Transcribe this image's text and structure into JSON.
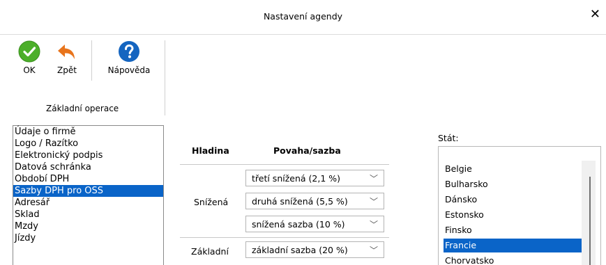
{
  "window": {
    "title": "Nastavení agendy",
    "close_glyph": "✕"
  },
  "toolbar": {
    "ok_label": "OK",
    "back_label": "Zpět",
    "help_label": "Nápověda",
    "group_label": "Základní operace",
    "icons": {
      "ok": "check-circle-icon",
      "back": "undo-arrow-icon",
      "help": "question-circle-icon"
    },
    "colors": {
      "ok": "#4caf2a",
      "back": "#e8741c",
      "help": "#1565c0"
    }
  },
  "sidebar": {
    "items": [
      {
        "label": "Údaje o firmě",
        "selected": false
      },
      {
        "label": "Logo / Razítko",
        "selected": false
      },
      {
        "label": "Elektronický podpis",
        "selected": false
      },
      {
        "label": "Datová schránka",
        "selected": false
      },
      {
        "label": "Období DPH",
        "selected": false
      },
      {
        "label": "Sazby DPH pro OSS",
        "selected": true
      },
      {
        "label": "Adresář",
        "selected": false
      },
      {
        "label": "Sklad",
        "selected": false
      },
      {
        "label": "Mzdy",
        "selected": false
      },
      {
        "label": "Jízdy",
        "selected": false
      }
    ]
  },
  "rates": {
    "header_level": "Hladina",
    "header_nature": "Povaha/sazba",
    "groups": [
      {
        "level": "Snížená",
        "rates": [
          "třetí snížená (2,1 %)",
          "druhá snížená (5,5 %)",
          "snížená sazba (10 %)"
        ]
      },
      {
        "level": "Základní",
        "rates": [
          "základní sazba (20 %)"
        ]
      }
    ]
  },
  "state": {
    "label": "Stát:",
    "items": [
      {
        "label": "Belgie",
        "selected": false
      },
      {
        "label": "Bulharsko",
        "selected": false
      },
      {
        "label": "Dánsko",
        "selected": false
      },
      {
        "label": "Estonsko",
        "selected": false
      },
      {
        "label": "Finsko",
        "selected": false
      },
      {
        "label": "Francie",
        "selected": true
      },
      {
        "label": "Chorvatsko",
        "selected": false
      }
    ]
  },
  "colors": {
    "selection": "#0a64c8"
  }
}
